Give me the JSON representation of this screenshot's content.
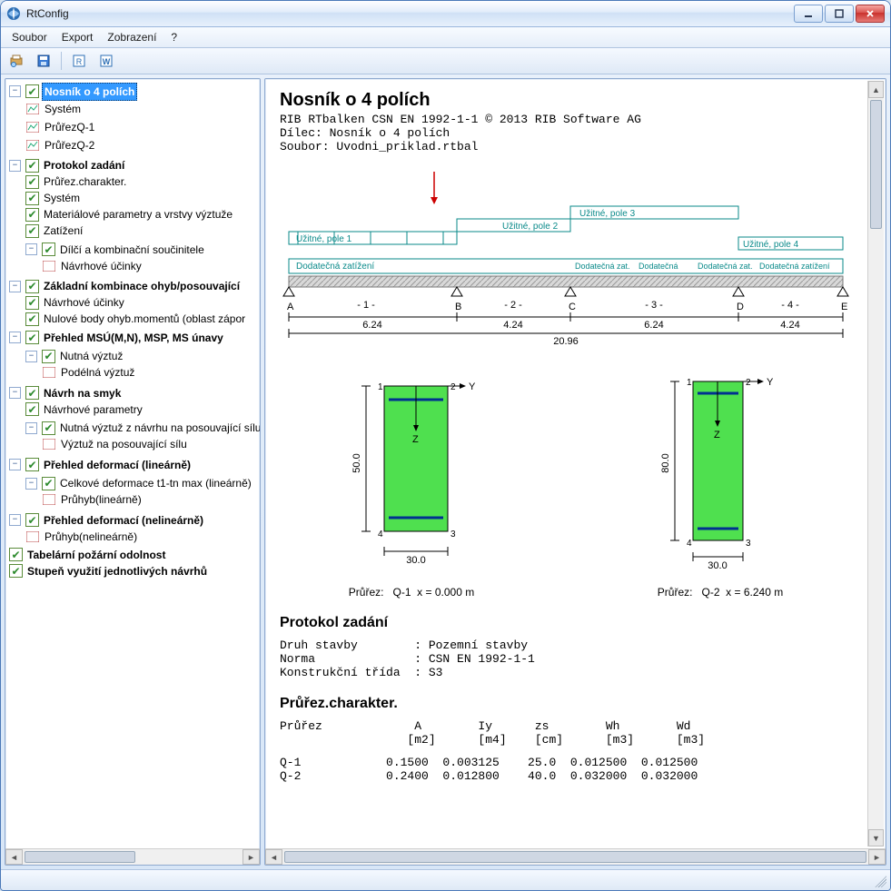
{
  "window": {
    "title": "RtConfig"
  },
  "menu": {
    "file": "Soubor",
    "export": "Export",
    "view": "Zobrazení",
    "help": "?"
  },
  "tree": {
    "root": "Nosník o 4 polích",
    "root_children": [
      "Systém",
      "PrůřezQ-1",
      "PrůřezQ-2"
    ],
    "protokol": "Protokol zadání",
    "protokol_items": [
      "Průřez.charakter.",
      "Systém",
      "Materiálové parametry a vrstvy výztuže",
      "Zatížení"
    ],
    "dilci": "Dílčí a kombinační součinitele",
    "dilci_item": "Návrhové účinky",
    "zk": "Základní kombinace ohyb/posouvající",
    "zk_items": [
      "Návrhové účinky",
      "Nulové body ohyb.momentů (oblast zápor"
    ],
    "prehled_msu": "Přehled MSÚ(M,N), MSP, MS únavy",
    "nutna_vyztuz": "Nutná výztuž",
    "podelna": "Podélná výztuž",
    "navrh_smyk": "Návrh na smyk",
    "navrh_param": "Návrhové parametry",
    "nutna_smyk": "Nutná výztuž z návrhu na posouvající sílu",
    "vyztuz_pos": "Výztuž na posouvající sílu",
    "def_lin": "Přehled deformací (lineárně)",
    "celkove": "Celkové deformace t1-tn max (lineárně)",
    "pruhyb_lin": "Průhyb(lineárně)",
    "def_nelin": "Přehled deformací (nelineárně)",
    "pruhyb_nelin": "Průhyb(nelineárně)",
    "pozarni": "Tabelární požární odolnost",
    "stupen": "Stupeň využití jednotlivých návrhů"
  },
  "doc": {
    "title": "Nosník o 4 polích",
    "sub1": "RIB RTbalken CSN EN 1992-1-1 © 2013 RIB Software AG",
    "sub2": "Dílec: Nosník o 4 polích",
    "sub3": "Soubor: Uvodni_priklad.rtbal",
    "h2a": "Protokol zadání",
    "p_lines": "Druh stavby        : Pozemní stavby\nNorma              : CSN EN 1992-1-1\nKonstrukční třída  : S3",
    "h2b": "Průřez.charakter.",
    "tbl_head": "Průřez             A        Iy      zs        Wh        Wd\n                  [m2]      [m4]    [cm]      [m3]      [m3]",
    "tbl_rows": "Q-1            0.1500  0.003125    25.0  0.012500  0.012500\nQ-2            0.2400  0.012800    40.0  0.032000  0.032000"
  },
  "fig": {
    "loads": {
      "u1": "Užitné, pole 1",
      "u2": "Užitné, pole 2",
      "u3": "Užitné, pole 3",
      "u4": "Užitné, pole 4",
      "d": "Dodatečná zatížení"
    },
    "supports": [
      "A",
      "B",
      "C",
      "D",
      "E"
    ],
    "span_labels": [
      "- 1 -",
      "- 2 -",
      "- 3 -",
      "- 4 -"
    ],
    "spans": [
      "6.24",
      "4.24",
      "6.24",
      "4.24"
    ],
    "total": "20.96",
    "sect1": {
      "name": "Průřez:",
      "id": "Q-1",
      "x": "x = 0.000 m",
      "w": "30.0",
      "h": "50.0"
    },
    "sect2": {
      "name": "Průřez:",
      "id": "Q-2",
      "x": "x = 6.240 m",
      "w": "30.0",
      "h": "80.0"
    }
  }
}
